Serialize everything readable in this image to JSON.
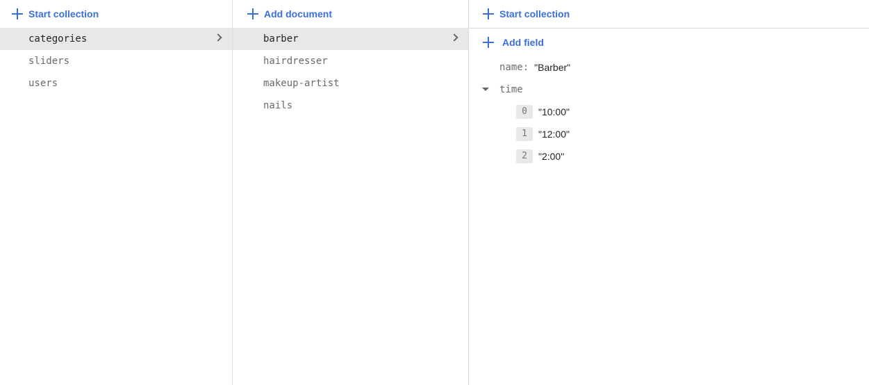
{
  "collections_panel": {
    "action_label": "Start collection",
    "items": [
      {
        "label": "categories",
        "selected": true
      },
      {
        "label": "sliders"
      },
      {
        "label": "users"
      }
    ]
  },
  "documents_panel": {
    "action_label": "Add document",
    "items": [
      {
        "label": "barber",
        "selected": true
      },
      {
        "label": "hairdresser"
      },
      {
        "label": "makeup-artist"
      },
      {
        "label": "nails"
      }
    ]
  },
  "fields_panel": {
    "action_label": "Start collection",
    "add_field_label": "Add field",
    "name_field": {
      "key": "name:",
      "value": "\"Barber\""
    },
    "time_field": {
      "key": "time",
      "items": [
        {
          "index": "0",
          "value": "\"10:00\""
        },
        {
          "index": "1",
          "value": "\"12:00\""
        },
        {
          "index": "2",
          "value": "\"2:00\""
        }
      ]
    }
  },
  "colors": {
    "accent": "#3b6fd8",
    "selected_bg": "#e8e8e8",
    "divider": "#dadada"
  }
}
